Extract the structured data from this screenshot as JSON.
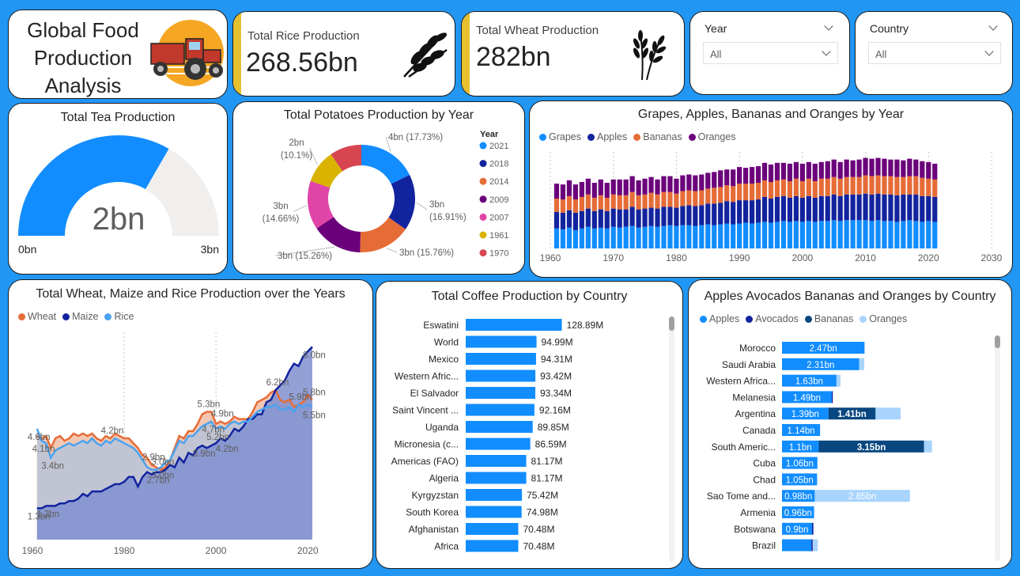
{
  "header": {
    "title_lines": [
      "Global Food",
      "Production",
      "Analysis"
    ]
  },
  "kpis": {
    "rice": {
      "label": "Total Rice Production",
      "value": "268.56bn"
    },
    "wheat": {
      "label": "Total Wheat Production",
      "value": "282bn"
    }
  },
  "slicers": {
    "year": {
      "label": "Year",
      "value": "All"
    },
    "country": {
      "label": "Country",
      "value": "All"
    }
  },
  "colors": {
    "accent_yellow": "#e6c12f",
    "light_blue": "#118dff",
    "dark_blue": "#12239e",
    "orange": "#e66c37",
    "purple": "#6b007b",
    "pink": "#e044a7",
    "gold": "#d9b300",
    "red": "#d64550",
    "gauge_bg": "#f0efee"
  },
  "chart_data": [
    {
      "id": "tea_gauge",
      "type": "gauge",
      "title": "Total Tea Production",
      "value": 2,
      "value_label": "2bn",
      "min": 0,
      "min_label": "0bn",
      "max": 3,
      "max_label": "3bn"
    },
    {
      "id": "potatoes_donut",
      "type": "pie",
      "title": "Total Potatoes Production by Year",
      "legend_title": "Year",
      "legend_position": "right",
      "slices": [
        {
          "name": "2021",
          "value": 17.73,
          "label": "4bn (17.73%)",
          "color": "#118dff"
        },
        {
          "name": "2018",
          "value": 16.91,
          "label_lines": [
            "3bn",
            "(16.91%)"
          ],
          "color": "#12239e"
        },
        {
          "name": "2014",
          "value": 15.76,
          "label": "3bn (15.76%)",
          "color": "#e66c37"
        },
        {
          "name": "2009",
          "value": 15.26,
          "label": "3bn (15.26%)",
          "color": "#6b007b"
        },
        {
          "name": "2007",
          "value": 14.66,
          "label_lines": [
            "3bn",
            "(14.66%)"
          ],
          "color": "#e044a7"
        },
        {
          "name": "1961",
          "value": 10.1,
          "label_lines": [
            "2bn",
            "(10.1%)"
          ],
          "color": "#d9b300"
        },
        {
          "name": "1970",
          "value": 9.58,
          "color": "#d64550"
        }
      ]
    },
    {
      "id": "fruits_by_year",
      "type": "bar",
      "stacked": true,
      "title": "Grapes, Apples, Bananas and Oranges by Year",
      "legend_position": "top-left",
      "x_ticks": [
        "1960",
        "1970",
        "1980",
        "1990",
        "2000",
        "2010",
        "2020",
        "2030"
      ],
      "x_range": [
        1960,
        2030
      ],
      "years": [
        1961,
        1962,
        1963,
        1964,
        1965,
        1966,
        1967,
        1968,
        1969,
        1970,
        1971,
        1972,
        1973,
        1974,
        1975,
        1976,
        1977,
        1978,
        1979,
        1980,
        1981,
        1982,
        1983,
        1984,
        1985,
        1986,
        1987,
        1988,
        1989,
        1990,
        1991,
        1992,
        1993,
        1994,
        1995,
        1996,
        1997,
        1998,
        1999,
        2000,
        2001,
        2002,
        2003,
        2004,
        2005,
        2006,
        2007,
        2008,
        2009,
        2010,
        2011,
        2012,
        2013,
        2014,
        2015,
        2016,
        2017,
        2018,
        2019,
        2020,
        2021
      ],
      "series": [
        {
          "name": "Grapes",
          "color": "#118dff",
          "values": [
            24,
            23,
            25,
            22,
            24,
            26,
            24,
            25,
            24,
            26,
            25,
            26,
            27,
            25,
            26,
            27,
            26,
            27,
            28,
            27,
            28,
            28,
            27,
            28,
            29,
            28,
            29,
            30,
            29,
            30,
            31,
            30,
            31,
            32,
            31,
            32,
            33,
            32,
            33,
            32,
            33,
            32,
            33,
            33,
            34,
            33,
            34,
            34,
            34,
            34,
            33,
            34,
            33,
            33,
            32,
            33,
            34,
            33,
            32,
            33,
            32
          ]
        },
        {
          "name": "Apples",
          "color": "#12239e",
          "values": [
            20,
            20,
            21,
            21,
            21,
            22,
            21,
            22,
            21,
            22,
            22,
            21,
            23,
            22,
            22,
            22,
            22,
            23,
            22,
            22,
            23,
            24,
            24,
            24,
            25,
            26,
            26,
            27,
            27,
            28,
            27,
            28,
            28,
            30,
            29,
            30,
            30,
            29,
            30,
            29,
            30,
            29,
            30,
            30,
            31,
            30,
            31,
            31,
            31,
            32,
            32,
            32,
            32,
            32,
            32,
            32,
            31,
            32,
            31,
            30,
            30
          ]
        },
        {
          "name": "Bananas",
          "color": "#e66c37",
          "values": [
            16,
            16,
            17,
            16,
            17,
            17,
            16,
            17,
            16,
            17,
            17,
            17,
            18,
            17,
            17,
            18,
            17,
            18,
            18,
            17,
            18,
            18,
            18,
            18,
            18,
            19,
            19,
            19,
            19,
            20,
            20,
            20,
            20,
            20,
            20,
            20,
            20,
            20,
            21,
            20,
            21,
            20,
            21,
            21,
            21,
            21,
            21,
            21,
            21,
            22,
            22,
            22,
            22,
            22,
            22,
            21,
            22,
            22,
            22,
            21,
            21
          ]
        },
        {
          "name": "Oranges",
          "color": "#6b007b",
          "values": [
            18,
            18,
            19,
            18,
            18,
            19,
            18,
            19,
            18,
            18,
            19,
            19,
            19,
            18,
            19,
            19,
            18,
            19,
            19,
            18,
            19,
            19,
            19,
            19,
            19,
            19,
            20,
            19,
            20,
            20,
            19,
            20,
            20,
            21,
            21,
            21,
            20,
            21,
            20,
            21,
            20,
            21,
            20,
            21,
            21,
            20,
            21,
            20,
            21,
            21,
            21,
            21,
            21,
            20,
            21,
            20,
            21,
            20,
            20,
            20,
            19
          ]
        }
      ]
    },
    {
      "id": "wheat_maize_rice",
      "type": "area",
      "title": "Total Wheat, Maize and Rice Production over the Years",
      "legend_position": "top-left",
      "x_ticks": [
        "1960",
        "1980",
        "2000",
        "2020"
      ],
      "x_range": [
        1960,
        2021
      ],
      "years": [
        1961,
        1962,
        1963,
        1964,
        1965,
        1966,
        1967,
        1968,
        1969,
        1970,
        1971,
        1972,
        1973,
        1974,
        1975,
        1976,
        1977,
        1978,
        1979,
        1980,
        1981,
        1982,
        1983,
        1984,
        1985,
        1986,
        1987,
        1988,
        1989,
        1990,
        1991,
        1992,
        1993,
        1994,
        1995,
        1996,
        1997,
        1998,
        1999,
        2000,
        2001,
        2002,
        2003,
        2004,
        2005,
        2006,
        2007,
        2008,
        2009,
        2010,
        2011,
        2012,
        2013,
        2014,
        2015,
        2016,
        2017,
        2018,
        2019,
        2020,
        2021
      ],
      "series": [
        {
          "name": "Wheat",
          "color": "#e66c37",
          "values": [
            4.3,
            4.2,
            4.3,
            3.8,
            4.2,
            4.3,
            4.1,
            4.2,
            4.4,
            4.3,
            4.4,
            4.3,
            4.4,
            4.2,
            4.1,
            4.3,
            4.2,
            4.4,
            4.3,
            4.2,
            4.2,
            4.0,
            3.8,
            3.5,
            3.4,
            3.1,
            3.0,
            2.9,
            3.0,
            3.3,
            3.8,
            4.3,
            4.2,
            4.5,
            4.5,
            4.8,
            5.2,
            5.3,
            5.3,
            4.8,
            4.9,
            4.8,
            4.9,
            5.1,
            5.0,
            5.0,
            5.0,
            5.3,
            5.7,
            5.8,
            5.9,
            6.1,
            6.2,
            5.8,
            5.7,
            5.8,
            5.5,
            5.6,
            5.7,
            6.0,
            5.8
          ]
        },
        {
          "name": "Maize",
          "color": "#12239e",
          "values": [
            1.3,
            1.3,
            1.4,
            1.4,
            1.4,
            1.5,
            1.5,
            1.6,
            1.6,
            1.7,
            1.9,
            1.8,
            2.0,
            2.0,
            2.0,
            2.1,
            2.2,
            2.3,
            2.3,
            2.4,
            2.6,
            2.6,
            2.2,
            2.6,
            2.8,
            2.7,
            2.8,
            2.8,
            2.9,
            3.1,
            3.0,
            3.4,
            3.2,
            3.6,
            3.5,
            3.8,
            3.9,
            3.8,
            3.9,
            4.0,
            4.2,
            4.1,
            4.3,
            4.6,
            4.5,
            4.7,
            5.0,
            5.0,
            5.2,
            5.2,
            5.7,
            5.8,
            6.2,
            6.4,
            6.6,
            7.0,
            7.3,
            7.2,
            7.6,
            7.8,
            8.0
          ]
        },
        {
          "name": "Rice",
          "color": "#4aa3f0",
          "values": [
            4.6,
            4.1,
            4.0,
            3.4,
            3.7,
            3.8,
            3.9,
            4.0,
            3.9,
            4.0,
            4.1,
            4.0,
            4.2,
            4.0,
            3.9,
            4.1,
            4.0,
            4.2,
            4.1,
            4.0,
            3.9,
            3.8,
            3.6,
            3.3,
            3.0,
            2.9,
            2.9,
            3.0,
            3.2,
            3.3,
            3.7,
            4.1,
            4.0,
            4.3,
            4.3,
            4.5,
            4.7,
            4.8,
            4.9,
            4.6,
            4.7,
            4.6,
            4.8,
            4.9,
            4.8,
            4.9,
            4.9,
            5.1,
            5.3,
            5.4,
            5.5,
            5.5,
            5.6,
            5.4,
            5.4,
            5.5,
            5.3,
            5.6,
            5.5,
            5.6,
            5.5
          ]
        }
      ],
      "data_labels": [
        {
          "text": "4.6bn",
          "series": "Rice",
          "year": 1961
        },
        {
          "text": "4.1bn",
          "series": "Rice",
          "year": 1962
        },
        {
          "text": "3.4bn",
          "series": "Rice",
          "year": 1964
        },
        {
          "text": "1.3bn",
          "series": "Maize",
          "year": 1961
        },
        {
          "text": "1.3bn",
          "series": "Maize",
          "year": 1963
        },
        {
          "text": "4.2bn",
          "series": "Wheat",
          "year": 1977
        },
        {
          "text": "2.9bn",
          "series": "Wheat",
          "year": 1986
        },
        {
          "text": "3.0bn",
          "series": "Wheat",
          "year": 1988
        },
        {
          "text": "3.0bn",
          "series": "Rice",
          "year": 1988
        },
        {
          "text": "2.7bn",
          "series": "Maize",
          "year": 1987
        },
        {
          "text": "5.3bn",
          "series": "Wheat",
          "year": 1998
        },
        {
          "text": "4.9bn",
          "series": "Wheat",
          "year": 2001
        },
        {
          "text": "5.2bn",
          "series": "Rice",
          "year": 2000
        },
        {
          "text": "4.7bn",
          "series": "Rice",
          "year": 1999
        },
        {
          "text": "4.2bn",
          "series": "Maize",
          "year": 2002
        },
        {
          "text": "3.9bn",
          "series": "Maize",
          "year": 1997
        },
        {
          "text": "6.2bn",
          "series": "Wheat",
          "year": 2013
        },
        {
          "text": "8.0bn",
          "series": "Maize",
          "year": 2021
        },
        {
          "text": "5.8bn",
          "series": "Wheat",
          "year": 2021
        },
        {
          "text": "5.9bn",
          "series": "Wheat",
          "year": 2018
        },
        {
          "text": "5.5bn",
          "series": "Rice",
          "year": 2021
        }
      ]
    },
    {
      "id": "coffee_by_country",
      "type": "bar",
      "orientation": "horizontal",
      "title": "Total Coffee Production by Country",
      "color": "#118dff",
      "x_max": 140,
      "categories": [
        "Eswatini",
        "World",
        "Mexico",
        "Western Afric...",
        "El Salvador",
        "Saint Vincent ...",
        "Uganda",
        "Micronesia (c...",
        "Americas (FAO)",
        "Algeria",
        "Kyrgyzstan",
        "South Korea",
        "Afghanistan",
        "Africa"
      ],
      "values": [
        128.89,
        94.99,
        94.31,
        93.42,
        93.34,
        92.16,
        89.85,
        86.59,
        81.17,
        81.17,
        75.42,
        74.98,
        70.48,
        70.48
      ],
      "labels": [
        "128.89M",
        "94.99M",
        "94.31M",
        "93.42M",
        "93.34M",
        "92.16M",
        "89.85M",
        "86.59M",
        "81.17M",
        "81.17M",
        "75.42M",
        "74.98M",
        "70.48M",
        "70.48M"
      ]
    },
    {
      "id": "fruits_by_country",
      "type": "bar",
      "orientation": "horizontal",
      "stacked": true,
      "title": "Apples Avocados Bananas and Oranges by Country",
      "legend_position": "top-left",
      "x_max": 6.2,
      "categories": [
        "Morocco",
        "Saudi Arabia",
        "Western Africa...",
        "Melanesia",
        "Argentina",
        "Canada",
        "South Americ...",
        "Cuba",
        "Chad",
        "Sao Tome and...",
        "Armenia",
        "Botswana",
        "Brazil"
      ],
      "series": [
        {
          "name": "Apples",
          "color": "#118dff",
          "values": [
            2.47,
            2.31,
            1.63,
            1.49,
            1.39,
            1.14,
            1.1,
            1.06,
            1.05,
            0.98,
            0.96,
            0.9,
            0.88
          ],
          "labels": [
            "2.47bn",
            "2.31bn",
            "1.63bn",
            "1.49bn",
            "1.39bn",
            "1.14bn",
            "1.1bn",
            "1.06bn",
            "1.05bn",
            "0.98bn",
            "0.96bn",
            "0.9bn",
            ""
          ]
        },
        {
          "name": "Avocados",
          "color": "#12239e",
          "values": [
            0,
            0,
            0,
            0.03,
            0,
            0,
            0,
            0,
            0,
            0,
            0,
            0.04,
            0.04
          ],
          "labels": [
            "",
            "",
            "",
            "",
            "",
            "",
            "",
            "",
            "",
            "",
            "",
            "",
            ""
          ]
        },
        {
          "name": "Bananas",
          "color": "#094780",
          "values": [
            0,
            0,
            0,
            0,
            1.41,
            0,
            3.15,
            0,
            0,
            0,
            0,
            0,
            0
          ],
          "labels": [
            "",
            "",
            "",
            "",
            "1.41bn",
            "",
            "3.15bn",
            "",
            "",
            "",
            "",
            "",
            ""
          ]
        },
        {
          "name": "Oranges",
          "color": "#a8d4fd",
          "values": [
            0,
            0.15,
            0.12,
            0,
            0.75,
            0,
            0.24,
            0,
            0,
            2.85,
            0,
            0,
            0.15
          ],
          "labels": [
            "",
            "",
            "",
            "",
            "",
            "",
            "",
            "",
            "",
            "2.85bn",
            "",
            "",
            ""
          ]
        }
      ]
    }
  ]
}
